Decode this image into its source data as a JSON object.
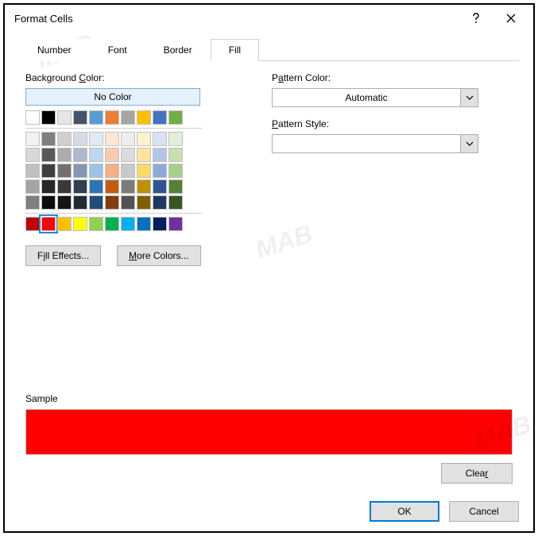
{
  "title": "Format Cells",
  "tabs": [
    "Number",
    "Font",
    "Border",
    "Fill"
  ],
  "activeTab": 3,
  "bgColorLabel": "Background Color:",
  "bgColorAccel": "C",
  "noColor": "No Color",
  "fillEffects": "Fill Effects...",
  "moreColors": "More Colors...",
  "patternColorLabel": "Pattern Color:",
  "patternColorAccel": "A",
  "patternColorValue": "Automatic",
  "patternStyleLabel": "Pattern Style:",
  "patternStyleAccel": "P",
  "patternStyleValue": "",
  "sampleLabel": "Sample",
  "sampleColor": "#FF0000",
  "clear": "Clear",
  "ok": "OK",
  "cancel": "Cancel",
  "selectedSwatch": "#FF0000",
  "watermark": "MAB",
  "paletteTop": [
    [
      "#FFFFFF",
      "#000000",
      "#E7E6E6",
      "#44546A",
      "#5B9BD5",
      "#ED7D31",
      "#A5A5A5",
      "#FFC000",
      "#4472C4",
      "#70AD47"
    ]
  ],
  "paletteMid": [
    [
      "#F2F2F2",
      "#7F7F7F",
      "#D0CECE",
      "#D6DCE4",
      "#DEEBF6",
      "#FBE5D5",
      "#EDEDED",
      "#FFF2CC",
      "#D9E2F3",
      "#E2EFD9"
    ],
    [
      "#D8D8D8",
      "#595959",
      "#AEABAB",
      "#ADB9CA",
      "#BDD7EE",
      "#F7CBAC",
      "#DBDBDB",
      "#FEE599",
      "#B4C6E7",
      "#C5E0B3"
    ],
    [
      "#BFBFBF",
      "#3F3F3F",
      "#757070",
      "#8496B0",
      "#9CC3E5",
      "#F4B183",
      "#C9C9C9",
      "#FFD965",
      "#8EAADB",
      "#A8D08D"
    ],
    [
      "#A5A5A5",
      "#262626",
      "#3A3838",
      "#323F4F",
      "#2E75B5",
      "#C55A11",
      "#7B7B7B",
      "#BF9000",
      "#2F5496",
      "#538135"
    ],
    [
      "#7F7F7F",
      "#0C0C0C",
      "#171616",
      "#222A35",
      "#1E4E79",
      "#833C0B",
      "#525252",
      "#7F6000",
      "#1F3864",
      "#375623"
    ]
  ],
  "paletteStd": [
    [
      "#C00000",
      "#FF0000",
      "#FFC000",
      "#FFFF00",
      "#92D050",
      "#00B050",
      "#00B0F0",
      "#0070C0",
      "#002060",
      "#7030A0"
    ]
  ]
}
